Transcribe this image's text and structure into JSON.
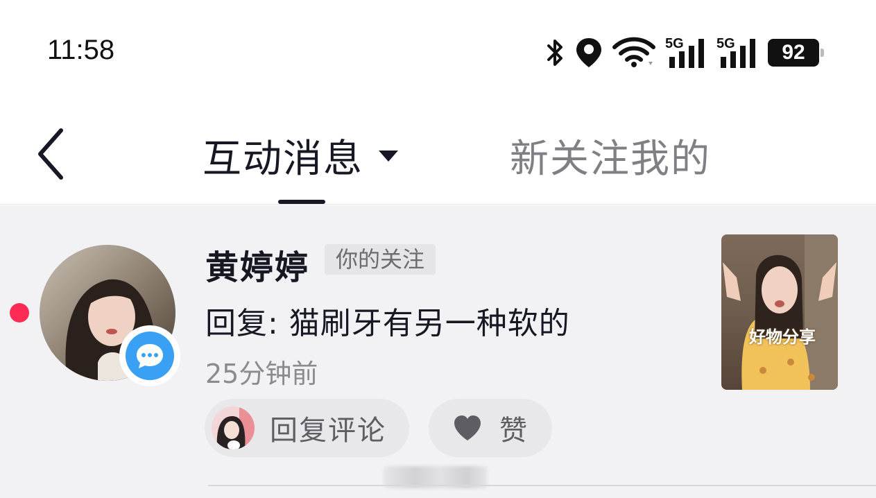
{
  "status_bar": {
    "time": "11:58",
    "network_tag_1": "5G",
    "network_tag_2": "5G",
    "battery": "92"
  },
  "header": {
    "active_tab": "互动消息",
    "other_tab": "新关注我的",
    "dropdown_icon": "caret-down-icon",
    "back_icon": "chevron-left-icon"
  },
  "notification": {
    "user_name": "黄婷婷",
    "relation_tag": "你的关注",
    "reply_text": "回复: 猫刷牙有另一种软的",
    "time_ago": "25分钟前",
    "reply_button_label": "回复评论",
    "like_button_label": "赞",
    "thumb_caption": "好物分享"
  },
  "colors": {
    "accent_red": "#fe2c55",
    "badge_blue": "#3aa0f3",
    "text_primary": "#161823",
    "text_secondary": "#7f7f85",
    "content_bg": "#f2f2f4"
  }
}
